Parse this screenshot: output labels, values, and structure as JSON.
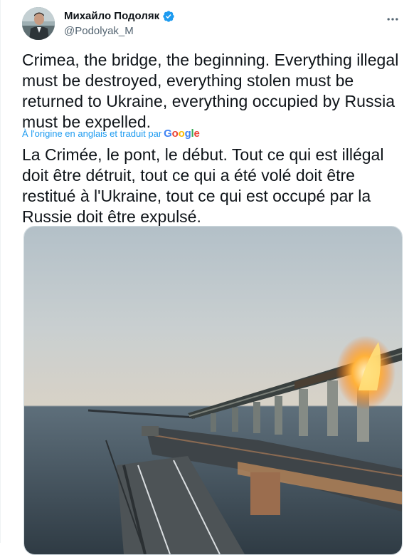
{
  "author": {
    "display_name": "Михайло Подоляк",
    "handle": "@Podolyak_M",
    "verified": true,
    "avatar_icon": "avatar-photo"
  },
  "tweet": {
    "text": "Crimea, the bridge, the beginning. Everything illegal must be destroyed, everything stolen must be returned to Ukraine, everything occupied by Russia must be expelled.",
    "translation_note": "À l'origine en anglais et traduit par",
    "translation_provider": "Google",
    "translated_text": "La Crimée, le pont, le début. Tout ce qui est illégal doit être détruit, tout ce qui a été volé doit être restitué à l'Ukraine, tout ce qui est occupé par la Russie doit être expulsé."
  },
  "icons": {
    "more": "more-options-icon",
    "verified": "verified-badge-icon",
    "media": "bridge-fire-photo"
  },
  "colors": {
    "link_blue": "#1d9bf0",
    "text": "#0f1419",
    "secondary": "#536471",
    "google_blue": "#4285f4",
    "google_red": "#ea4335",
    "google_yellow": "#fbbc05",
    "google_green": "#34a853"
  }
}
